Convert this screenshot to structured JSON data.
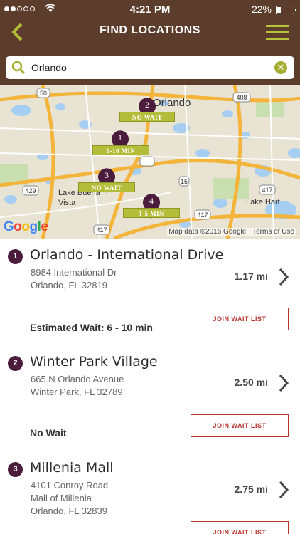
{
  "status_bar": {
    "time": "4:21 PM",
    "battery": "22%"
  },
  "header": {
    "title": "FIND LOCATIONS"
  },
  "search": {
    "value": "Orlando"
  },
  "map": {
    "city_label": "Orlando",
    "town_labels": [
      "Lake Buena Vista",
      "Lake Hart"
    ],
    "pins": [
      {
        "number": "1",
        "wait": "6-10 MIN"
      },
      {
        "number": "2",
        "wait": "NO WAIT"
      },
      {
        "number": "3",
        "wait": "NO WAIT"
      },
      {
        "number": "4",
        "wait": "1-5 MIN"
      }
    ],
    "road_shields": [
      "50",
      "408",
      "429",
      "417",
      "417",
      "417",
      "15"
    ],
    "attribution": {
      "provider": "Google",
      "data": "Map data ©2016 Google",
      "terms": "Terms of Use"
    }
  },
  "locations": [
    {
      "number": "1",
      "name": "Orlando - International Drive",
      "address_line1": "8984 International Dr",
      "address_line2": "Orlando, FL 32819",
      "address_line3": "",
      "distance": "1.17 mi",
      "wait": "Estimated Wait: 6 - 10 min",
      "button": "JOIN WAIT LIST"
    },
    {
      "number": "2",
      "name": "Winter Park Village",
      "address_line1": "665 N Orlando Avenue",
      "address_line2": "Winter Park, FL 32789",
      "address_line3": "",
      "distance": "2.50 mi",
      "wait": "No Wait",
      "button": "JOIN WAIT LIST"
    },
    {
      "number": "3",
      "name": "Millenia Mall",
      "address_line1": "4101 Conroy Road",
      "address_line2": "Mall of Millenia",
      "address_line3": "Orlando, FL 32839",
      "distance": "2.75 mi",
      "wait": "",
      "button": "JOIN WAIT LIST"
    }
  ],
  "colors": {
    "header_bg": "#5c3d2b",
    "accent_green": "#b4bd3a",
    "pin_purple": "#4c1c3d",
    "button_red": "#b8352f"
  }
}
